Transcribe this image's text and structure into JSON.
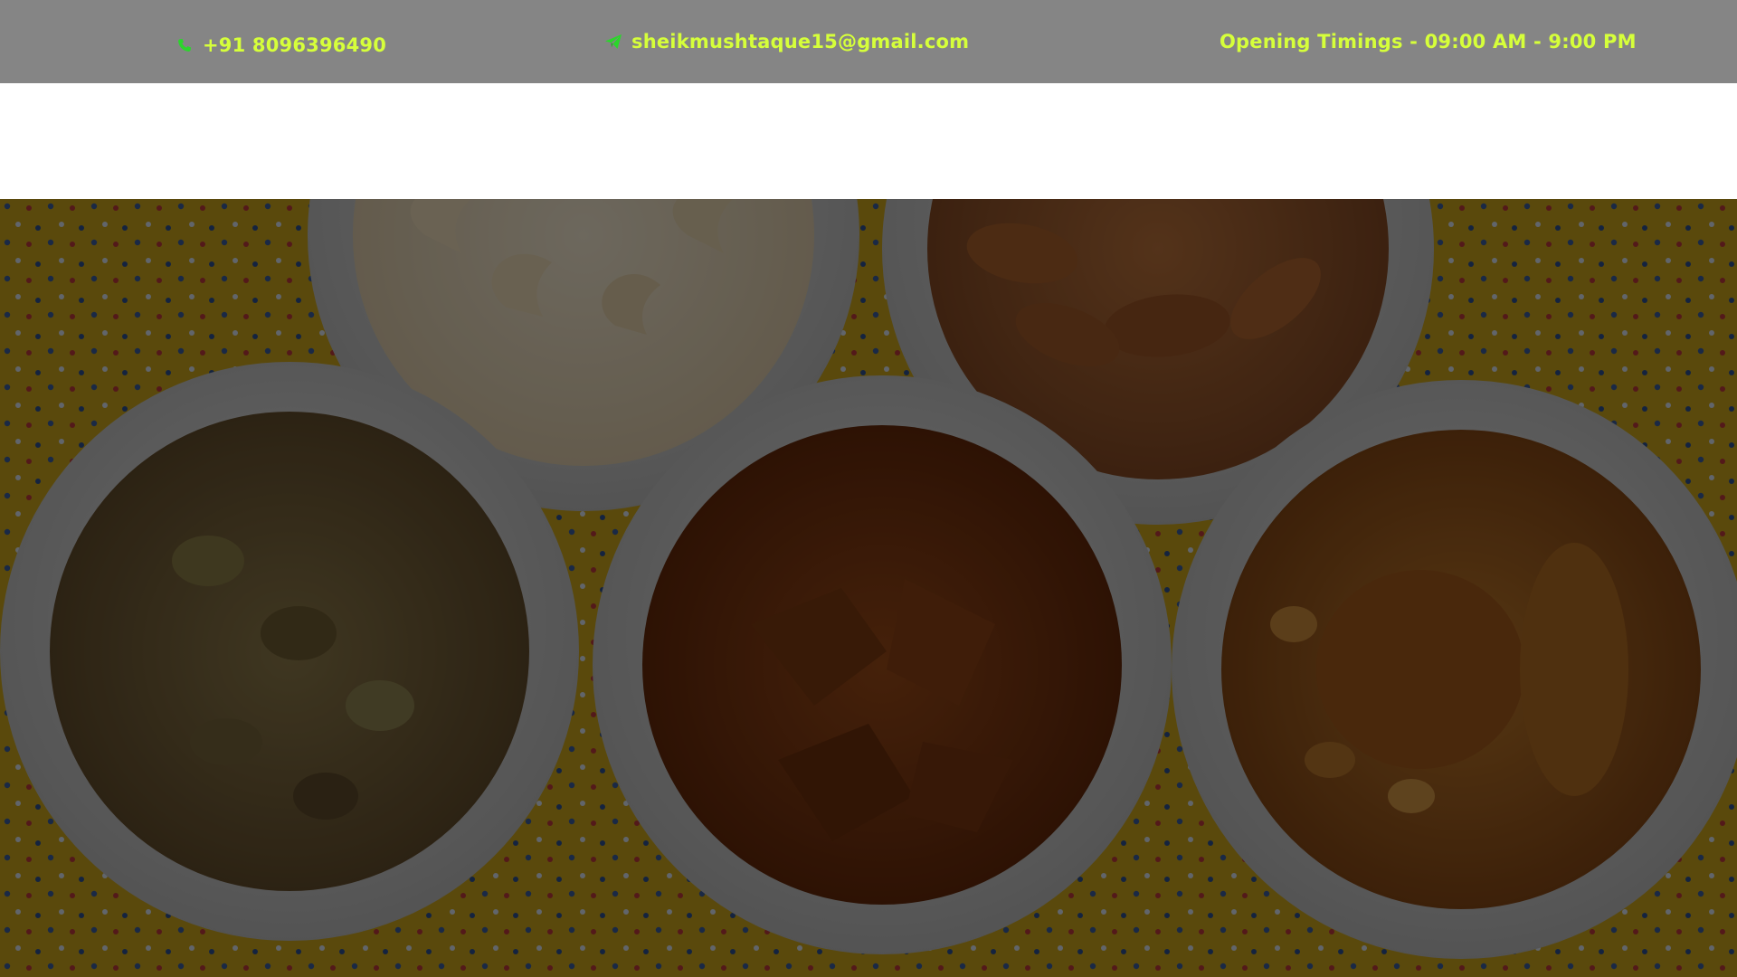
{
  "colors": {
    "topbar_bg": "#858585",
    "topbar_text": "#d6ff3a",
    "icon_green": "#2bd62b",
    "navbar_bg": "#ffffff",
    "hero_overlay": "rgba(0,0,0,0.55)"
  },
  "topbar": {
    "phone": {
      "icon": "phone-icon",
      "text": "+91 8096396490"
    },
    "email": {
      "icon": "paper-plane-icon",
      "text": "sheikmushtaque15@gmail.com"
    },
    "hours": {
      "text": "Opening Timings - 09:00 AM - 9:00 PM"
    }
  },
  "hero": {
    "image": "bowls-of-dry-fruits",
    "bowls": [
      "cashews",
      "almonds",
      "pistachios",
      "dates",
      "raisins-and-apricots"
    ]
  }
}
